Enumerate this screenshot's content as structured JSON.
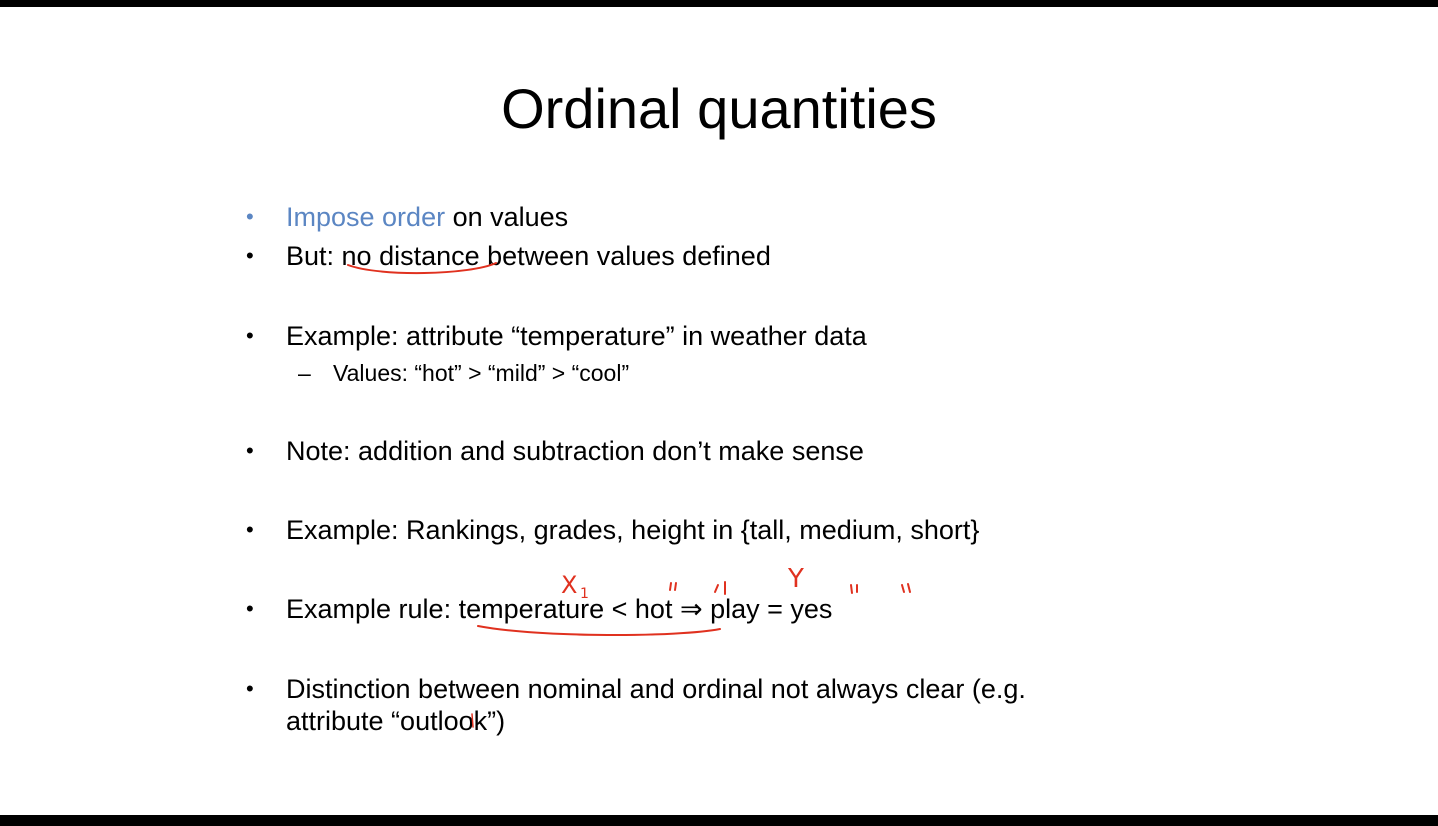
{
  "slide": {
    "title": "Ordinal quantities",
    "bullets": [
      {
        "accent": "Impose order",
        "rest": " on values"
      },
      {
        "text": "But: no distance between values defined"
      },
      {
        "text": "Example: attribute “temperature” in weather data"
      },
      {
        "sub": "Values: “hot” > “mild” > “cool”"
      },
      {
        "text": "Note: addition and subtraction don’t make sense"
      },
      {
        "text": "Example: Rankings, grades, height in {tall, medium, short}"
      },
      {
        "text": "Example rule: temperature < hot ⇒ play = yes"
      },
      {
        "line1": "Distinction between nominal and ordinal not always clear (e.g.",
        "line2": "attribute “outlook”)"
      }
    ],
    "bullet_glyph": "•",
    "dash_glyph": "–"
  },
  "annotations": {
    "ink_color": "#e0311f",
    "x1_label": "X",
    "x1_subscript": "1",
    "y_label": "Y"
  }
}
